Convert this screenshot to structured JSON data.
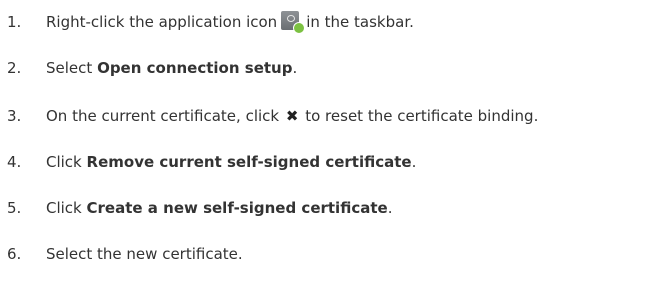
{
  "steps": [
    {
      "number": "1.",
      "before_icon": "Right-click the application icon",
      "icon": "application-icon",
      "after_icon": "in the taskbar."
    },
    {
      "number": "2.",
      "prefix": "Select",
      "bold": "Open connection setup",
      "suffix": "."
    },
    {
      "number": "3.",
      "before_icon": "On the current certificate, click",
      "icon": "close-x-icon",
      "icon_glyph": "✖",
      "after_icon": "to reset the certificate binding."
    },
    {
      "number": "4.",
      "prefix": "Click",
      "bold": "Remove current self-signed certificate",
      "suffix": "."
    },
    {
      "number": "5.",
      "prefix": "Click",
      "bold": "Create a new self-signed certificate",
      "suffix": "."
    },
    {
      "number": "6.",
      "text": "Select the new certificate."
    }
  ]
}
